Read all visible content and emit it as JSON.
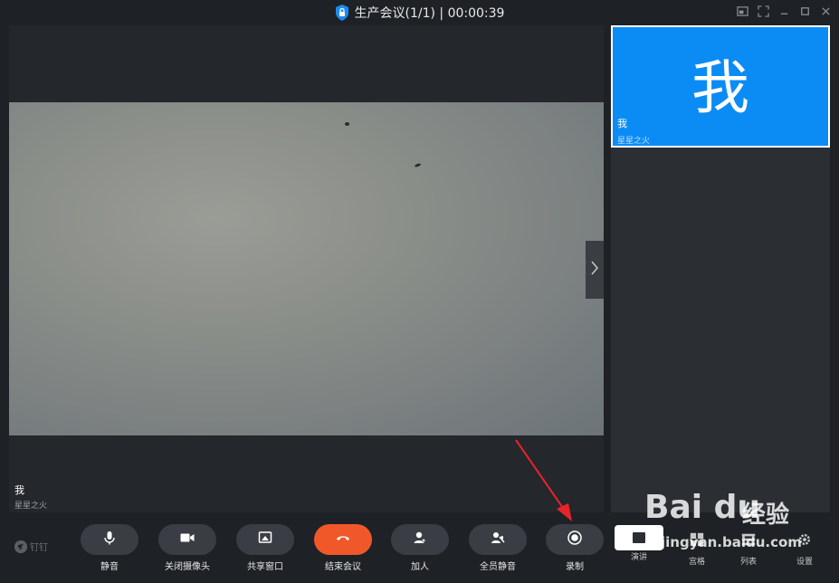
{
  "titlebar": {
    "title": "生产会议(1/1) | 00:00:39"
  },
  "main_video": {
    "participant_name": "我",
    "participant_sub": "星星之火"
  },
  "side_panel": {
    "tile_avatar": "我",
    "tile_name": "我",
    "tile_sub": "星星之火",
    "accent_color": "#0b8cf5"
  },
  "toolbar": {
    "brand": "钉钉",
    "mute_label": "静音",
    "camera_label": "关闭摄像头",
    "share_label": "共享窗口",
    "end_label": "结束会议",
    "add_label": "加人",
    "mute_all_label": "全员静音",
    "record_label": "录制",
    "present_label": "演讲",
    "grid_label": "宫格",
    "list_label": "列表",
    "settings_label": "设置",
    "end_color": "#f0582a"
  },
  "watermark": {
    "logo": "Bai du",
    "cn": "经验",
    "url": "jingyan.baidu.com"
  }
}
